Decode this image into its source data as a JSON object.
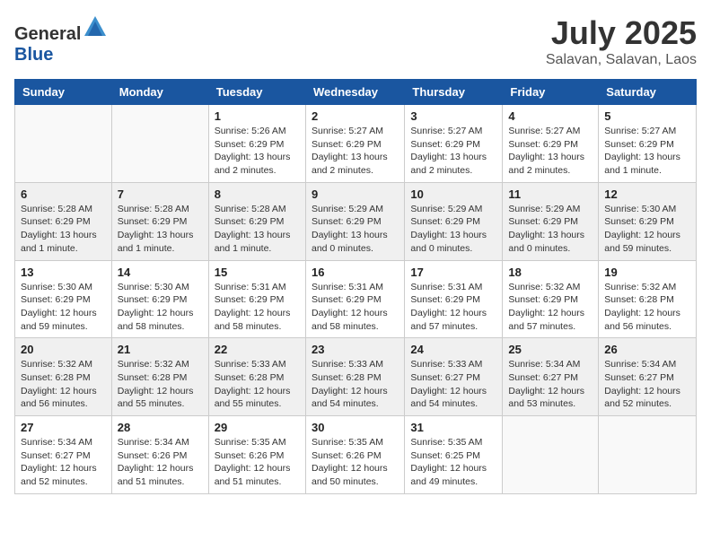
{
  "header": {
    "logo_general": "General",
    "logo_blue": "Blue",
    "month_year": "July 2025",
    "location": "Salavan, Salavan, Laos"
  },
  "weekdays": [
    "Sunday",
    "Monday",
    "Tuesday",
    "Wednesday",
    "Thursday",
    "Friday",
    "Saturday"
  ],
  "weeks": [
    [
      {
        "day": "",
        "info": ""
      },
      {
        "day": "",
        "info": ""
      },
      {
        "day": "1",
        "info": "Sunrise: 5:26 AM\nSunset: 6:29 PM\nDaylight: 13 hours and 2 minutes."
      },
      {
        "day": "2",
        "info": "Sunrise: 5:27 AM\nSunset: 6:29 PM\nDaylight: 13 hours and 2 minutes."
      },
      {
        "day": "3",
        "info": "Sunrise: 5:27 AM\nSunset: 6:29 PM\nDaylight: 13 hours and 2 minutes."
      },
      {
        "day": "4",
        "info": "Sunrise: 5:27 AM\nSunset: 6:29 PM\nDaylight: 13 hours and 2 minutes."
      },
      {
        "day": "5",
        "info": "Sunrise: 5:27 AM\nSunset: 6:29 PM\nDaylight: 13 hours and 1 minute."
      }
    ],
    [
      {
        "day": "6",
        "info": "Sunrise: 5:28 AM\nSunset: 6:29 PM\nDaylight: 13 hours and 1 minute."
      },
      {
        "day": "7",
        "info": "Sunrise: 5:28 AM\nSunset: 6:29 PM\nDaylight: 13 hours and 1 minute."
      },
      {
        "day": "8",
        "info": "Sunrise: 5:28 AM\nSunset: 6:29 PM\nDaylight: 13 hours and 1 minute."
      },
      {
        "day": "9",
        "info": "Sunrise: 5:29 AM\nSunset: 6:29 PM\nDaylight: 13 hours and 0 minutes."
      },
      {
        "day": "10",
        "info": "Sunrise: 5:29 AM\nSunset: 6:29 PM\nDaylight: 13 hours and 0 minutes."
      },
      {
        "day": "11",
        "info": "Sunrise: 5:29 AM\nSunset: 6:29 PM\nDaylight: 13 hours and 0 minutes."
      },
      {
        "day": "12",
        "info": "Sunrise: 5:30 AM\nSunset: 6:29 PM\nDaylight: 12 hours and 59 minutes."
      }
    ],
    [
      {
        "day": "13",
        "info": "Sunrise: 5:30 AM\nSunset: 6:29 PM\nDaylight: 12 hours and 59 minutes."
      },
      {
        "day": "14",
        "info": "Sunrise: 5:30 AM\nSunset: 6:29 PM\nDaylight: 12 hours and 58 minutes."
      },
      {
        "day": "15",
        "info": "Sunrise: 5:31 AM\nSunset: 6:29 PM\nDaylight: 12 hours and 58 minutes."
      },
      {
        "day": "16",
        "info": "Sunrise: 5:31 AM\nSunset: 6:29 PM\nDaylight: 12 hours and 58 minutes."
      },
      {
        "day": "17",
        "info": "Sunrise: 5:31 AM\nSunset: 6:29 PM\nDaylight: 12 hours and 57 minutes."
      },
      {
        "day": "18",
        "info": "Sunrise: 5:32 AM\nSunset: 6:29 PM\nDaylight: 12 hours and 57 minutes."
      },
      {
        "day": "19",
        "info": "Sunrise: 5:32 AM\nSunset: 6:28 PM\nDaylight: 12 hours and 56 minutes."
      }
    ],
    [
      {
        "day": "20",
        "info": "Sunrise: 5:32 AM\nSunset: 6:28 PM\nDaylight: 12 hours and 56 minutes."
      },
      {
        "day": "21",
        "info": "Sunrise: 5:32 AM\nSunset: 6:28 PM\nDaylight: 12 hours and 55 minutes."
      },
      {
        "day": "22",
        "info": "Sunrise: 5:33 AM\nSunset: 6:28 PM\nDaylight: 12 hours and 55 minutes."
      },
      {
        "day": "23",
        "info": "Sunrise: 5:33 AM\nSunset: 6:28 PM\nDaylight: 12 hours and 54 minutes."
      },
      {
        "day": "24",
        "info": "Sunrise: 5:33 AM\nSunset: 6:27 PM\nDaylight: 12 hours and 54 minutes."
      },
      {
        "day": "25",
        "info": "Sunrise: 5:34 AM\nSunset: 6:27 PM\nDaylight: 12 hours and 53 minutes."
      },
      {
        "day": "26",
        "info": "Sunrise: 5:34 AM\nSunset: 6:27 PM\nDaylight: 12 hours and 52 minutes."
      }
    ],
    [
      {
        "day": "27",
        "info": "Sunrise: 5:34 AM\nSunset: 6:27 PM\nDaylight: 12 hours and 52 minutes."
      },
      {
        "day": "28",
        "info": "Sunrise: 5:34 AM\nSunset: 6:26 PM\nDaylight: 12 hours and 51 minutes."
      },
      {
        "day": "29",
        "info": "Sunrise: 5:35 AM\nSunset: 6:26 PM\nDaylight: 12 hours and 51 minutes."
      },
      {
        "day": "30",
        "info": "Sunrise: 5:35 AM\nSunset: 6:26 PM\nDaylight: 12 hours and 50 minutes."
      },
      {
        "day": "31",
        "info": "Sunrise: 5:35 AM\nSunset: 6:25 PM\nDaylight: 12 hours and 49 minutes."
      },
      {
        "day": "",
        "info": ""
      },
      {
        "day": "",
        "info": ""
      }
    ]
  ]
}
